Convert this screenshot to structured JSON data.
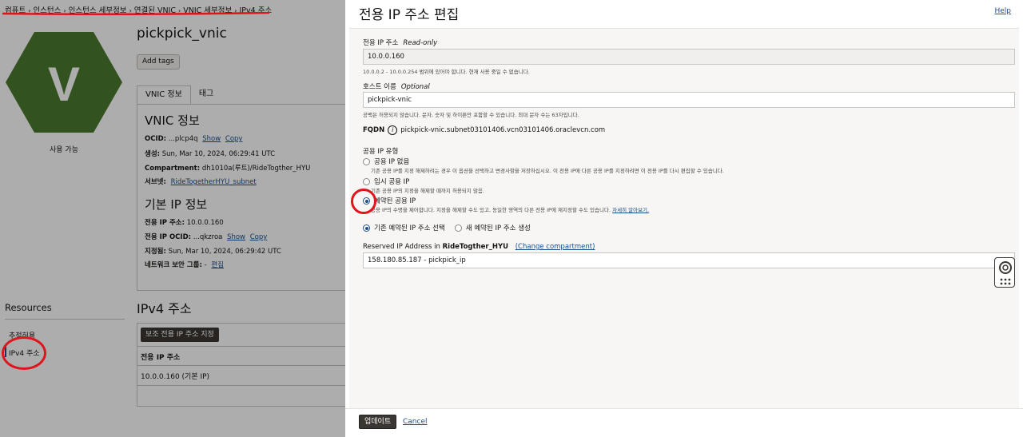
{
  "breadcrumb": {
    "items": [
      "컴퓨트",
      "인스턴스",
      "인스턴스 세부정보",
      "연결된 VNIC",
      "VNIC 세부정보"
    ],
    "current": "IPv4 주소",
    "separator": "›"
  },
  "vnic": {
    "badge_letter": "V",
    "status": "사용 가능",
    "name": "pickpick_vnic",
    "add_tags_label": "Add tags",
    "tabs": [
      "VNIC 정보",
      "태그"
    ],
    "info_title": "VNIC 정보",
    "ocid_label": "OCID:",
    "ocid_value": "...plcp4q",
    "show_label": "Show",
    "copy_label": "Copy",
    "created_label": "생성:",
    "created_value": "Sun, Mar 10, 2024, 06:29:41 UTC",
    "compartment_label": "Compartment:",
    "compartment_value": "dh1010a(루트)/RideTogther_HYU",
    "subnet_label": "서브넷:",
    "subnet_value": "RideTogetherHYU_subnet",
    "primary_ip_title": "기본 IP 정보",
    "private_ip_label": "전용 IP 주소:",
    "private_ip_value": "10.0.0.160",
    "private_ip_ocid_label": "전용 IP OCID:",
    "private_ip_ocid_value": "...qkzroa",
    "assigned_label": "지정됨:",
    "assigned_value": "Sun, Mar 10, 2024, 06:29:42 UTC",
    "nsg_label": "네트워크 보안 그룹:",
    "nsg_value": "-",
    "nsg_edit": "편집"
  },
  "resources": {
    "title": "Resources",
    "items": [
      "추적허용",
      "IPv4 주소"
    ]
  },
  "ipv4": {
    "title": "IPv4 주소",
    "assign_button": "보조 전용 IP 주소 지정",
    "column": "전용 IP 주소",
    "row": "10.0.0.160 (기본 IP)"
  },
  "drawer": {
    "title": "전용 IP 주소 편집",
    "help": "Help",
    "private_ip_label": "전용 IP 주소",
    "private_ip_hint": "Read-only",
    "private_ip_value": "10.0.0.160",
    "private_ip_help": "10.0.0.2 - 10.0.0.254 범위에 있어야 합니다. 현재 사용 중일 수 없습니다.",
    "hostname_label": "호스트 이름",
    "hostname_hint": "Optional",
    "hostname_value": "pickpick-vnic",
    "hostname_help": "공백은 허용되지 않습니다. 문자, 숫자 및 하이픈만 포함할 수 있습니다. 최대 문자 수는 63자입니다.",
    "fqdn_label": "FQDN",
    "fqdn_value": "pickpick-vnic.subnet03101406.vcn03101406.oraclevcn.com",
    "public_ip_type_label": "공용 IP 유형",
    "option_none": "공용 IP 없음",
    "option_none_help": "기존 공용 IP를 지정 해제하려는 경우 이 옵션을 선택하고 변경사항을 저장하십시오. 이 전용 IP에 다른 공용 IP를 지정하려면 이 전용 IP를 다시 편집할 수 있습니다.",
    "option_ephemeral": "임시 공용 IP",
    "option_ephemeral_help": "기존 공용 IP의 지정을 해제할 때까지 허용되지 않음.",
    "option_reserved": "예약된 공용 IP",
    "option_reserved_help": "공용 IP의 수명을 제어합니다. 지정을 해제할 수도 있고, 동일한 영역의 다른 전용 IP에 재지정할 수도 있습니다.",
    "learn_more": "자세히 알아보기.",
    "existing_reserved": "기존 예약된 IP 주소 선택",
    "new_reserved": "새 예약된 IP 주소 생성",
    "reserved_ip_label_prefix": "Reserved IP Address in",
    "reserved_ip_compartment": "RideTogther_HYU",
    "change_compartment": "(Change compartment)",
    "reserved_ip_value": "158.180.85.187 - pickpick_ip",
    "update_button": "업데이트",
    "cancel": "Cancel"
  },
  "colors": {
    "annotation": "#e0141d",
    "hexagon": "#4a7a2e",
    "link": "#1a4f8c"
  },
  "icons": [
    "info-icon",
    "lifebuoy-icon",
    "apps-grid-icon"
  ]
}
